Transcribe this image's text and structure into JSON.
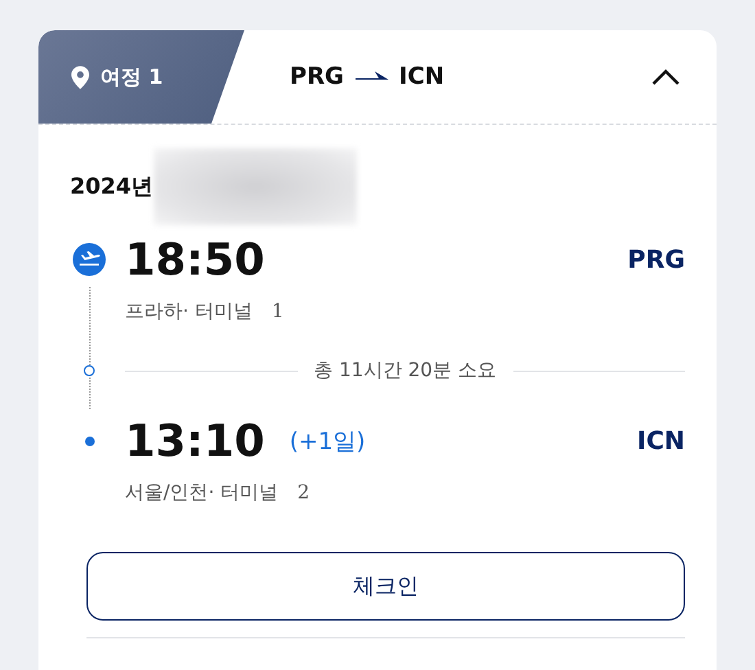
{
  "trip_tab": {
    "label": "여정 1"
  },
  "route": {
    "origin": "PRG",
    "destination": "ICN",
    "expanded": true
  },
  "date": "2024년",
  "departure": {
    "time": "18:50",
    "airport": "PRG",
    "place": "프라하·  터미널",
    "terminal": "1"
  },
  "duration": "총 11시간 20분 소요",
  "arrival": {
    "time": "13:10",
    "day_offset": "(+1일)",
    "airport": "ICN",
    "place": "서울/인천·  터미널",
    "terminal": "2"
  },
  "buttons": [
    {
      "label": "체크인"
    }
  ]
}
